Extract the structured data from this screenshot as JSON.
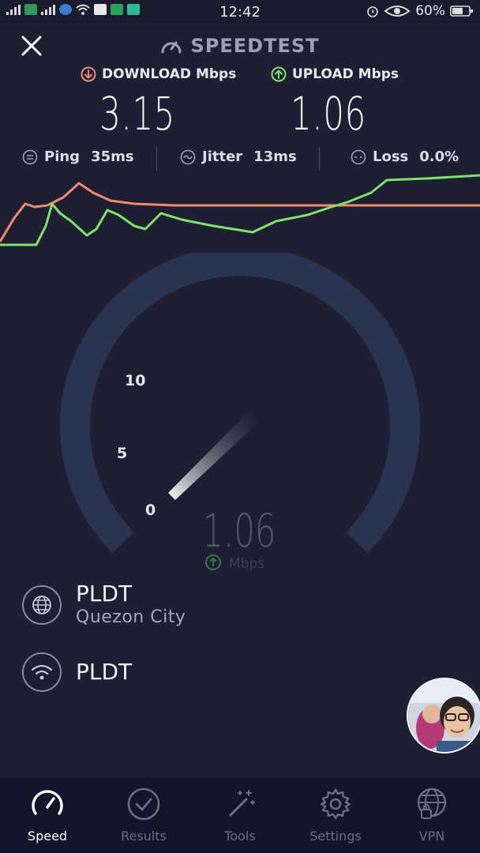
{
  "status_bar": {
    "time": "12:42",
    "battery": "60%"
  },
  "header": {
    "title": "SPEEDTEST"
  },
  "results": {
    "download_label": "DOWNLOAD Mbps",
    "upload_label": "UPLOAD Mbps",
    "download_value": "3.15",
    "upload_value": "1.06"
  },
  "stats": {
    "ping_label": "Ping",
    "ping_value": "35ms",
    "jitter_label": "Jitter",
    "jitter_value": "13ms",
    "loss_label": "Loss",
    "loss_value": "0.0%"
  },
  "gauge": {
    "ticks": [
      "10",
      "5",
      "0"
    ],
    "current_value": "1.06",
    "unit": "Mbps"
  },
  "isp": {
    "provider": "PLDT",
    "location": "Quezon City",
    "network": "PLDT"
  },
  "tabs": [
    {
      "label": "Speed",
      "icon": "speedometer-icon",
      "active": true
    },
    {
      "label": "Results",
      "icon": "checkmark-icon",
      "active": false
    },
    {
      "label": "Tools",
      "icon": "magic-wand-icon",
      "active": false
    },
    {
      "label": "Settings",
      "icon": "gear-icon",
      "active": false
    },
    {
      "label": "VPN",
      "icon": "globe-lock-icon",
      "active": false
    }
  ],
  "colors": {
    "background": "#1e1f33",
    "download": "#f08a6e",
    "upload": "#7fe36a",
    "gauge_track": "#2a3350"
  }
}
